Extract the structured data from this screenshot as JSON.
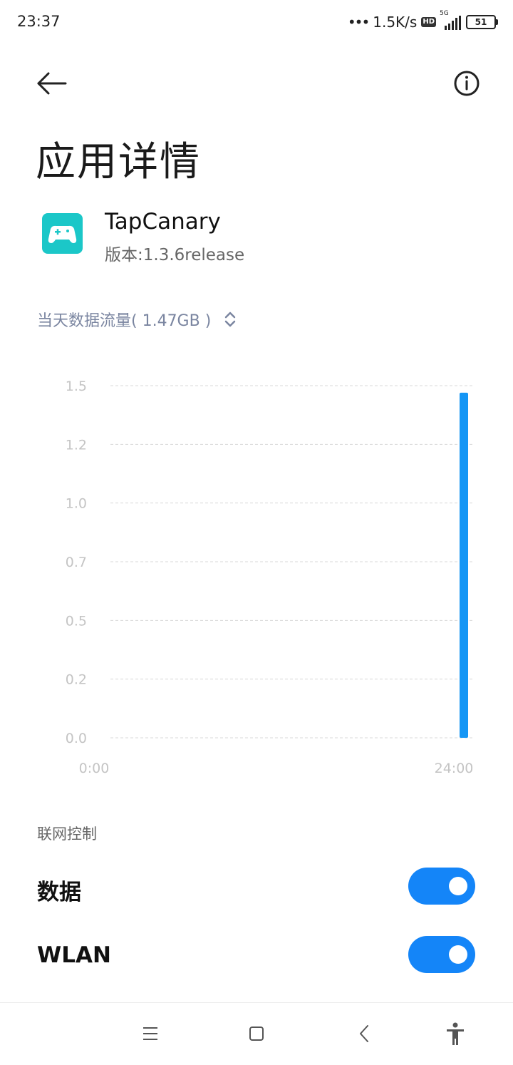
{
  "status_bar": {
    "time": "23:37",
    "net_speed": "1.5K/s",
    "hd_badge": "HD",
    "network_type": "5G",
    "battery": "51"
  },
  "header": {
    "title": "应用详情"
  },
  "app": {
    "name": "TapCanary",
    "version": "版本:1.3.6release",
    "icon": "gamepad-icon",
    "icon_color": "#1bc7c8"
  },
  "usage": {
    "label": "当天数据流量( 1.47GB )"
  },
  "chart_data": {
    "type": "bar",
    "x_labels": [
      "0:00",
      "24:00"
    ],
    "x": [
      "23:00"
    ],
    "values": [
      1.47
    ],
    "yticks": [
      "0.0",
      "0.2",
      "0.5",
      "0.7",
      "1.0",
      "1.2",
      "1.5"
    ],
    "ylim": [
      0,
      1.5
    ],
    "grid": true,
    "bar_color": "#1596f5"
  },
  "network_control": {
    "section_label": "联网控制",
    "rows": [
      {
        "label": "数据",
        "enabled": true
      },
      {
        "label": "WLAN",
        "enabled": true
      }
    ]
  },
  "colors": {
    "accent": "#1485f8"
  }
}
